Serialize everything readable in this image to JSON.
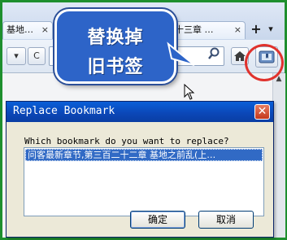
{
  "browser": {
    "tabs": [
      {
        "label": "基地…",
        "close": "×"
      },
      {
        "label": "十三章 …",
        "close": "×"
      }
    ],
    "new_tab": "+",
    "nav": {
      "dropdown": "▾",
      "reload": "C",
      "search_glyph": "🔍",
      "home_glyph": "⌂"
    }
  },
  "callout": {
    "line1": "替换掉",
    "line2": "旧书签"
  },
  "dialog": {
    "title": "Replace Bookmark",
    "close": "✕",
    "prompt": "Which bookmark do you want to replace?",
    "bookmarks": [
      "问客最新章节,第三百二十二章 基地之前乱(上…"
    ],
    "ok_label": "确定",
    "cancel_label": "取消"
  },
  "colors": {
    "frame": "#1e8f2e",
    "callout": "#2d64c8",
    "highlight": "#e0322d",
    "selection": "#316ac5"
  }
}
